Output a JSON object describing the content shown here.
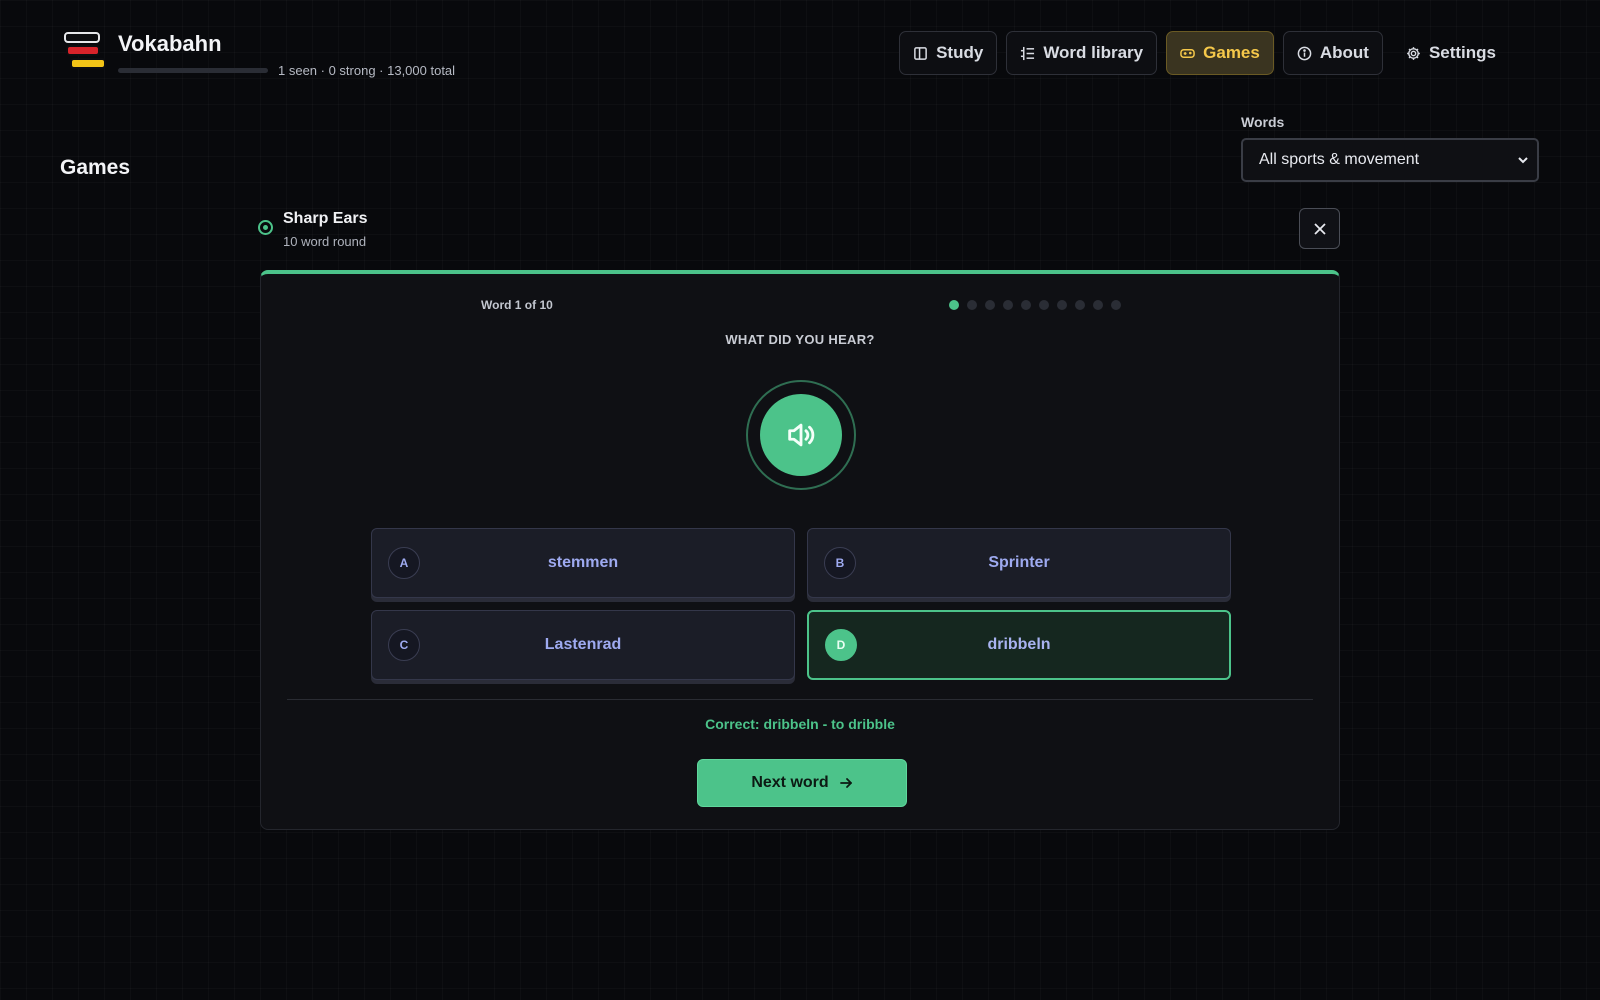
{
  "header": {
    "app_title": "Vokabahn",
    "stats": "1 seen · 0 strong · 13,000 total",
    "progress_fraction": 0.0001
  },
  "nav": {
    "items": [
      {
        "label": "Study",
        "icon": "book-icon"
      },
      {
        "label": "Word library",
        "icon": "list-icon"
      },
      {
        "label": "Games",
        "icon": "gamepad-icon",
        "active": true
      },
      {
        "label": "About",
        "icon": "info-icon"
      },
      {
        "label": "Settings",
        "icon": "gear-icon"
      }
    ]
  },
  "page": {
    "title": "Games"
  },
  "filter": {
    "label": "Words",
    "selected": "All sports & movement"
  },
  "game": {
    "name": "Sharp Ears",
    "meta": "10 word round",
    "counter": "Word 1 of 10",
    "current_index": 1,
    "total_words": 10,
    "prompt": "WHAT DID YOU HEAR?",
    "options": [
      {
        "letter": "A",
        "word": "stemmen"
      },
      {
        "letter": "B",
        "word": "Sprinter"
      },
      {
        "letter": "C",
        "word": "Lastenrad"
      },
      {
        "letter": "D",
        "word": "dribbeln",
        "correct": true
      }
    ],
    "feedback": "Correct: dribbeln - to dribble",
    "next_label": "Next word"
  },
  "colors": {
    "accent": "#4cc38a",
    "active_nav": "#f5c84a",
    "option_text": "#9eaaf0"
  }
}
